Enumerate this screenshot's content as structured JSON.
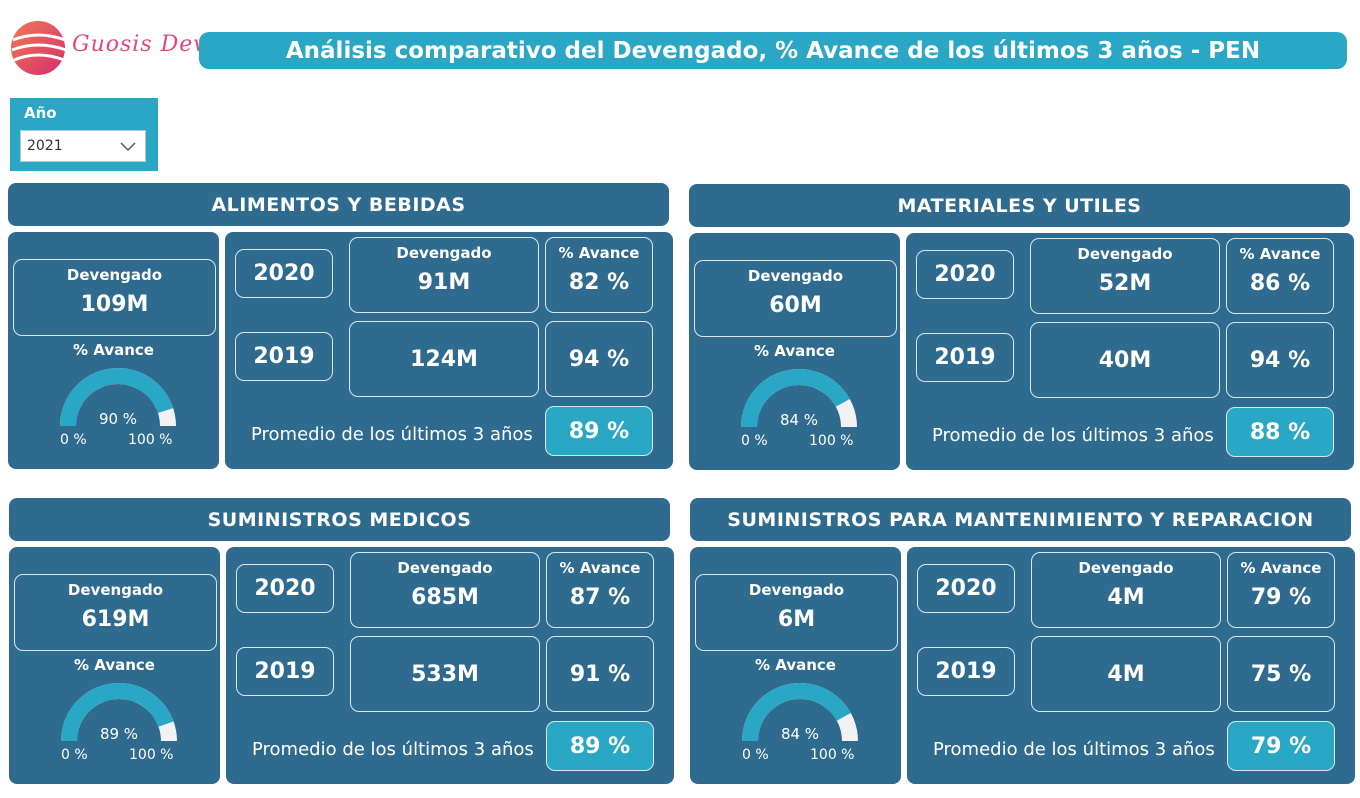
{
  "brand": {
    "logo_text": "Guosis Dev"
  },
  "header": {
    "title": "Análisis comparativo del Devengado, % Avance de los últimos 3 años - PEN"
  },
  "slicer": {
    "label": "Año",
    "value": "2021"
  },
  "common": {
    "devengado_label": "Devengado",
    "avance_label": "% Avance",
    "gauge_min": "0 %",
    "gauge_max": "100 %",
    "promedio_label": "Promedio de los últimos 3 años"
  },
  "colors": {
    "accent": "#2ba7c6",
    "panel": "#2f6b8e",
    "gauge_track": "#f2f2f2"
  },
  "panels": [
    {
      "title": "ALIMENTOS Y BEBIDAS",
      "devengado": "109M",
      "avance": "90 %",
      "avance_value": 90,
      "rows": [
        {
          "year": "2020",
          "devengado": "91M",
          "avance": "82 %"
        },
        {
          "year": "2019",
          "devengado": "124M",
          "avance": "94 %"
        }
      ],
      "promedio": "89 %"
    },
    {
      "title": "MATERIALES Y  UTILES",
      "devengado": "60M",
      "avance": "84 %",
      "avance_value": 84,
      "rows": [
        {
          "year": "2020",
          "devengado": "52M",
          "avance": "86 %"
        },
        {
          "year": "2019",
          "devengado": "40M",
          "avance": "94 %"
        }
      ],
      "promedio": "88 %"
    },
    {
      "title": "SUMINISTROS MEDICOS",
      "devengado": "619M",
      "avance": "89 %",
      "avance_value": 89,
      "rows": [
        {
          "year": "2020",
          "devengado": "685M",
          "avance": "87 %"
        },
        {
          "year": "2019",
          "devengado": "533M",
          "avance": "91 %"
        }
      ],
      "promedio": "89 %"
    },
    {
      "title": "SUMINISTROS PARA MANTENIMIENTO Y REPARACION",
      "devengado": "6M",
      "avance": "84 %",
      "avance_value": 84,
      "rows": [
        {
          "year": "2020",
          "devengado": "4M",
          "avance": "79 %"
        },
        {
          "year": "2019",
          "devengado": "4M",
          "avance": "75 %"
        }
      ],
      "promedio": "79 %"
    }
  ]
}
